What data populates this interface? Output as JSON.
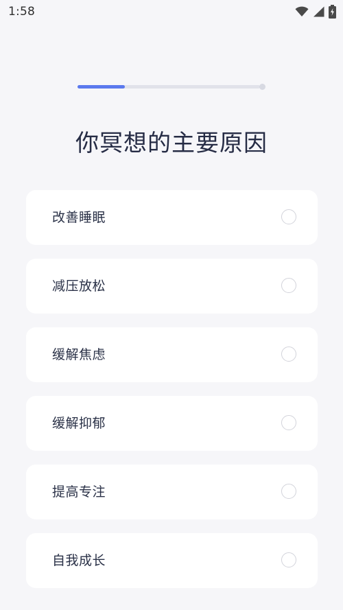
{
  "status_bar": {
    "time": "1:58",
    "icons": [
      "wifi-icon",
      "signal-icon",
      "battery-charging-icon"
    ]
  },
  "progress": {
    "fraction": 0.26
  },
  "title": "你冥想的主要原因",
  "options": [
    {
      "label": "改善睡眠",
      "selected": false
    },
    {
      "label": "减压放松",
      "selected": false
    },
    {
      "label": "缓解焦虑",
      "selected": false
    },
    {
      "label": "缓解抑郁",
      "selected": false
    },
    {
      "label": "提高专注",
      "selected": false
    },
    {
      "label": "自我成长",
      "selected": false
    }
  ],
  "colors": {
    "background": "#f6f6f9",
    "accent": "#5b79ee",
    "card": "#ffffff",
    "text": "#262c45"
  }
}
